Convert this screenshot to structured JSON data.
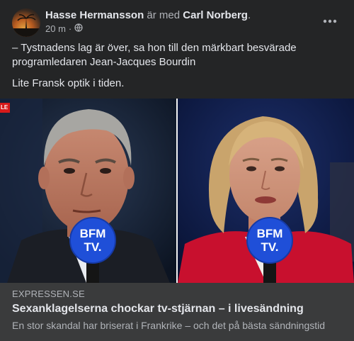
{
  "post": {
    "author": "Hasse Hermansson",
    "with_text": "är med",
    "tagged": "Carl Norberg",
    "period": ".",
    "time": "20 m",
    "separator": "·",
    "audience_icon": "globe-icon",
    "more_icon": "ellipsis-icon",
    "more_label": "•••",
    "text_lines": [
      "– Tystnadens lag är över, sa hon till den märkbart besvärade programledaren Jean-Jacques Bourdin",
      "Lite Fransk optik i tiden."
    ]
  },
  "image": {
    "live_tag": "LE",
    "left_mic_logo": [
      "BFM",
      "TV."
    ],
    "right_mic_logo": [
      "BFM",
      "TV."
    ]
  },
  "link_preview": {
    "domain": "EXPRESSEN.SE",
    "headline": "Sexanklagelserna chockar tv-stjärnan – i livesändning",
    "description": "En stor skandal har briserat i Frankrike – och det på bästa sändningstid"
  },
  "colors": {
    "background": "#242526",
    "preview_bg": "#3a3b3c",
    "mic_blue": "#1f4fd8",
    "jacket_red": "#c8102e"
  }
}
